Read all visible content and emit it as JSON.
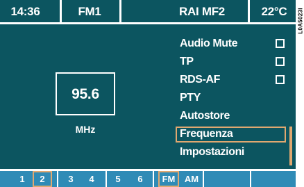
{
  "header": {
    "time": "14:36",
    "band": "FM1",
    "station": "RAI MF2",
    "temperature": "22°C"
  },
  "frequency": {
    "value": "95.6",
    "unit": "MHz"
  },
  "menu": {
    "items": [
      {
        "label": "Audio Mute",
        "checkbox": true,
        "checked": false
      },
      {
        "label": "TP",
        "checkbox": true,
        "checked": false
      },
      {
        "label": "RDS-AF",
        "checkbox": true,
        "checked": false
      },
      {
        "label": "PTY",
        "checkbox": false
      },
      {
        "label": "Autostore",
        "checkbox": false
      },
      {
        "label": "Frequenza",
        "checkbox": false,
        "selected": true
      },
      {
        "label": "Impostazioni",
        "checkbox": false
      }
    ]
  },
  "presets": {
    "items": [
      "1",
      "2",
      "3",
      "4",
      "5",
      "6"
    ],
    "active": "2",
    "bands": [
      "FM",
      "AM"
    ],
    "active_band": "FM"
  },
  "side_code": "L0A5023I",
  "colors": {
    "background": "#0c5560",
    "preset_bar": "#2f8bb6",
    "highlight": "#e0a870",
    "text": "#ffffff"
  }
}
